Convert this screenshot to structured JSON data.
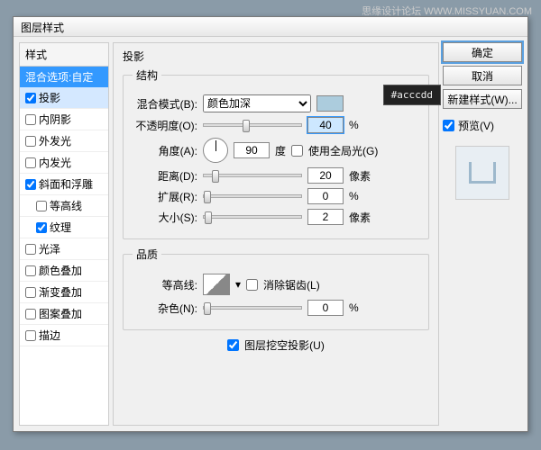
{
  "watermark": "思缘设计论坛   WWW.MISSYUAN.COM",
  "dialog_title": "图层样式",
  "sidebar": {
    "header": "样式",
    "blend": "混合选项:自定",
    "items": [
      {
        "label": "投影",
        "checked": true,
        "active": true
      },
      {
        "label": "内阴影",
        "checked": false
      },
      {
        "label": "外发光",
        "checked": false
      },
      {
        "label": "内发光",
        "checked": false
      },
      {
        "label": "斜面和浮雕",
        "checked": true
      },
      {
        "label": "等高线",
        "checked": false,
        "indent": true
      },
      {
        "label": "纹理",
        "checked": true,
        "indent": true
      },
      {
        "label": "光泽",
        "checked": false
      },
      {
        "label": "颜色叠加",
        "checked": false
      },
      {
        "label": "渐变叠加",
        "checked": false
      },
      {
        "label": "图案叠加",
        "checked": false
      },
      {
        "label": "描边",
        "checked": false
      }
    ]
  },
  "main": {
    "title": "投影",
    "structure": {
      "legend": "结构",
      "blend_label": "混合模式(B):",
      "blend_value": "颜色加深",
      "color_hex": "#acccdd",
      "opacity_label": "不透明度(O):",
      "opacity_value": "40",
      "opacity_unit": "%",
      "angle_label": "角度(A):",
      "angle_value": "90",
      "angle_unit": "度",
      "global_light": "使用全局光(G)",
      "global_light_checked": false,
      "distance_label": "距离(D):",
      "distance_value": "20",
      "distance_unit": "像素",
      "spread_label": "扩展(R):",
      "spread_value": "0",
      "spread_unit": "%",
      "size_label": "大小(S):",
      "size_value": "2",
      "size_unit": "像素"
    },
    "quality": {
      "legend": "品质",
      "contour_label": "等高线:",
      "antialias": "消除锯齿(L)",
      "antialias_checked": false,
      "noise_label": "杂色(N):",
      "noise_value": "0",
      "noise_unit": "%"
    },
    "knockout": {
      "label": "图层挖空投影(U)",
      "checked": true
    }
  },
  "buttons": {
    "ok": "确定",
    "cancel": "取消",
    "new_style": "新建样式(W)...",
    "preview": "预览(V)",
    "preview_checked": true
  }
}
